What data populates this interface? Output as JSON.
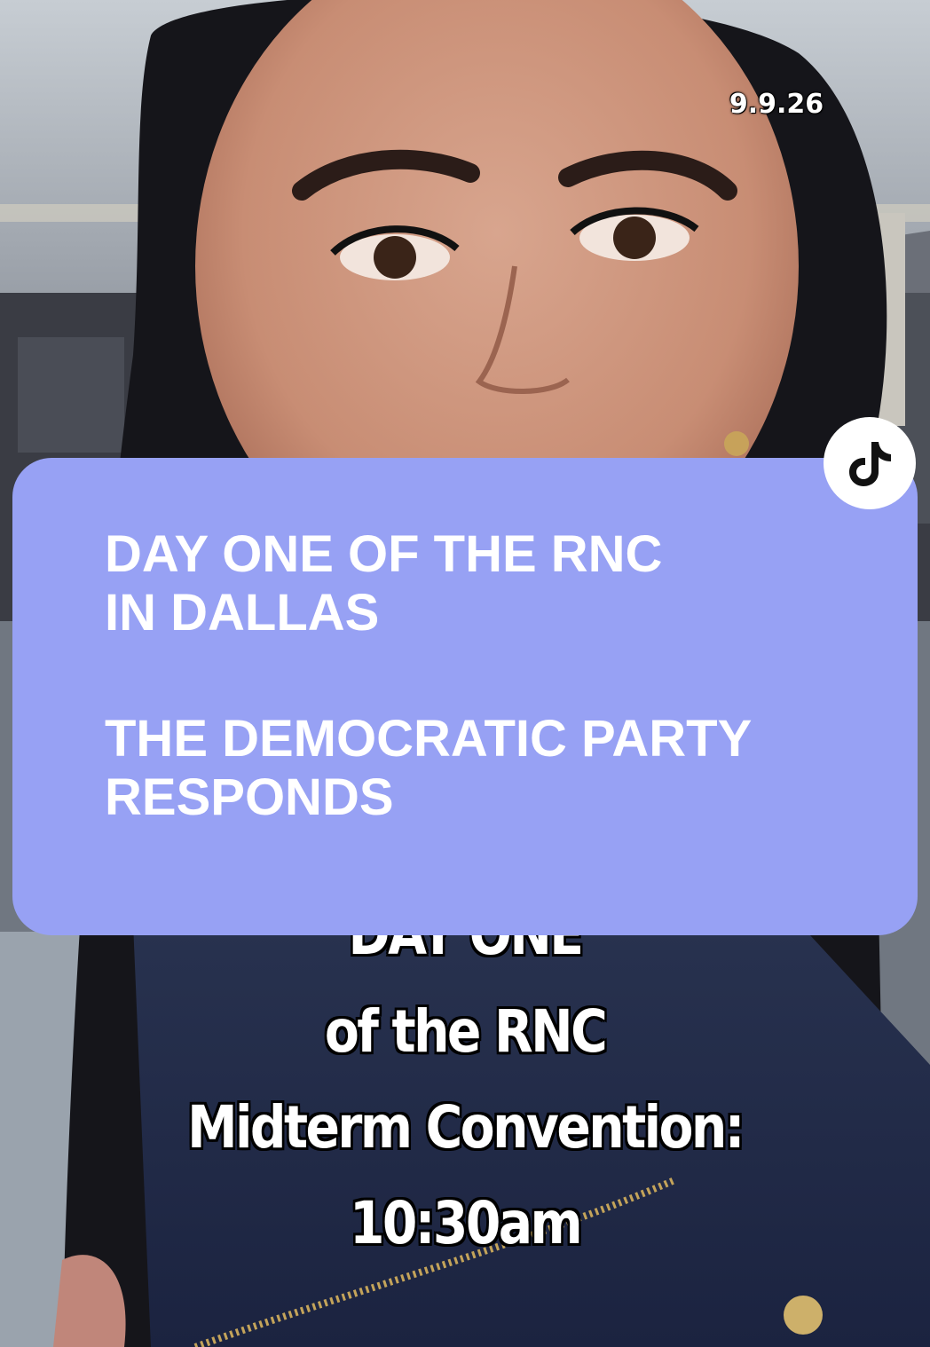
{
  "video": {
    "date_stamp": "9.9.26",
    "platform_icon": "tiktok-logo-icon"
  },
  "banner": {
    "lines_block_1": [
      "DAY ONE OF THE RNC",
      "IN DALLAS"
    ],
    "lines_block_2": [
      "THE DEMOCRATIC PARTY",
      "RESPONDS"
    ],
    "background_color": "#97a1f4",
    "text_color": "#ffffff"
  },
  "caption": {
    "partial_line": "DAY ONE",
    "line_2": "of the RNC",
    "line_3": "Midterm Convention:",
    "line_4": "10:30am"
  }
}
